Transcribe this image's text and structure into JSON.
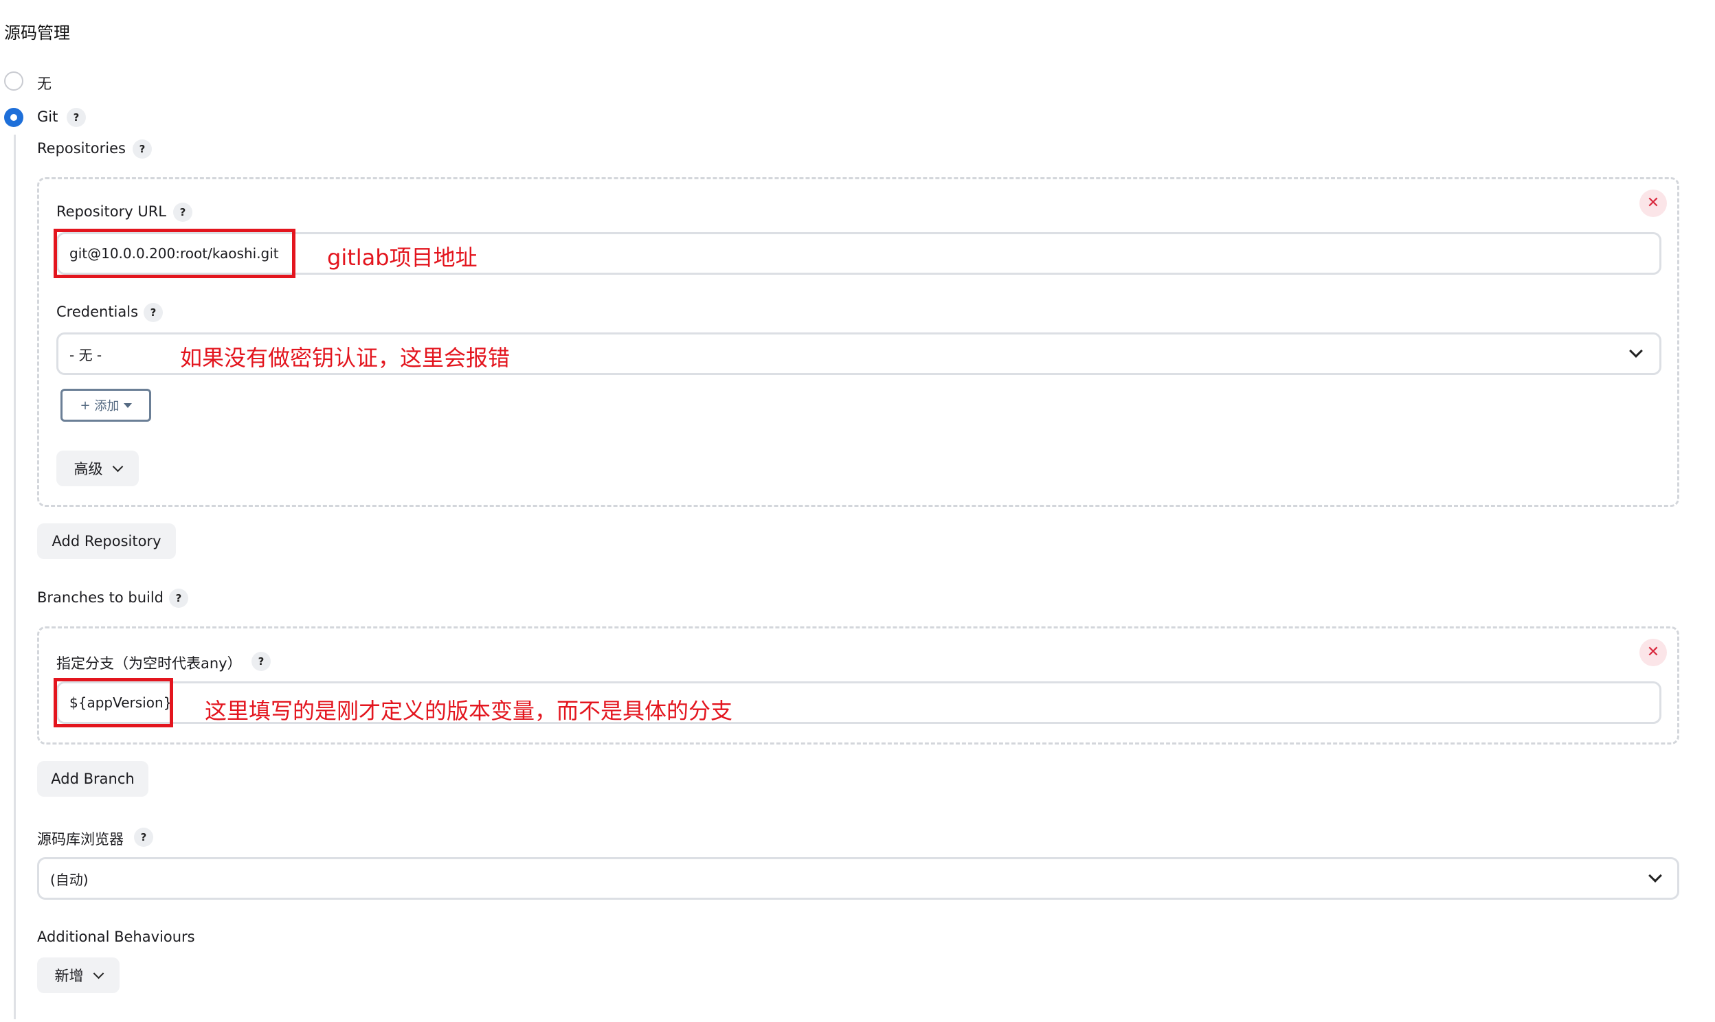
{
  "section_title": "源码管理",
  "scm": {
    "options": [
      {
        "label": "无",
        "checked": false
      },
      {
        "label": "Git",
        "checked": true
      }
    ]
  },
  "repositories": {
    "label": "Repositories",
    "url_label": "Repository URL",
    "url_value": "git@10.0.0.200:root/kaoshi.git",
    "url_annotation": "gitlab项目地址",
    "credentials_label": "Credentials",
    "credentials_value": "- 无 -",
    "credentials_annotation": "如果没有做密钥认证，这里会报错",
    "add_label": "添加",
    "advanced_label": "高级",
    "add_repository_label": "Add Repository"
  },
  "branches": {
    "label": "Branches to build",
    "specifier_label": "指定分支（为空时代表any）",
    "specifier_value": "${appVersion}",
    "specifier_annotation": "这里填写的是刚才定义的版本变量，而不是具体的分支",
    "add_branch_label": "Add Branch"
  },
  "browser": {
    "label": "源码库浏览器",
    "value": "(自动)"
  },
  "behaviours": {
    "label": "Additional Behaviours",
    "add_label": "新增"
  },
  "colors": {
    "radio_checked": "#1e6fd9",
    "annotation_red": "#e3151e",
    "close_red": "#d8263b"
  },
  "icons": {
    "help": "question-mark-icon",
    "close": "close-x-icon",
    "dropdown": "chevron-down-icon"
  }
}
